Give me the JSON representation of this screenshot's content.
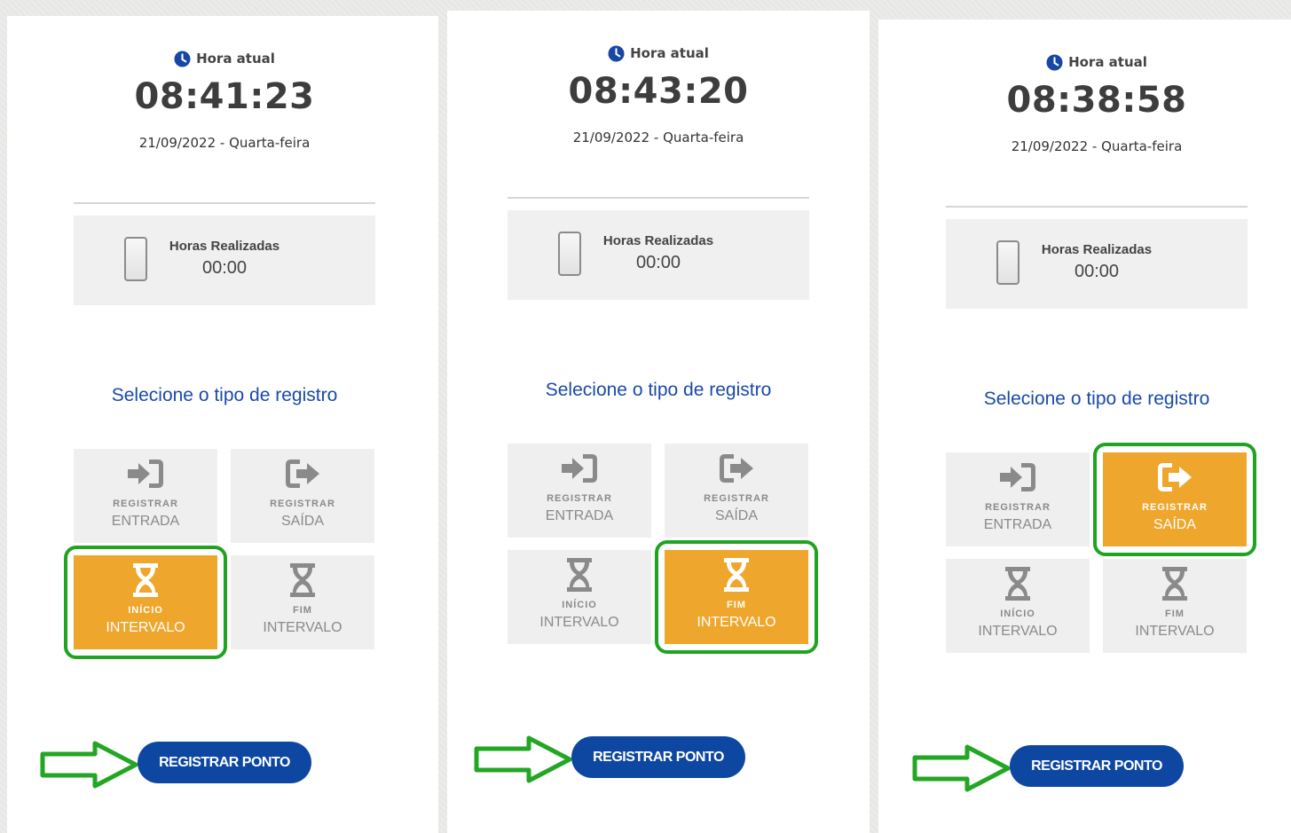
{
  "colors": {
    "accent_blue": "#0d47a1",
    "title_blue": "#1a4aa8",
    "selected_orange": "#efa62c",
    "highlight_green": "#20a320",
    "button_gray": "#efefef"
  },
  "icons": {
    "clock": "clock-icon",
    "device": "phone-icon",
    "entrada": "sign-in-arrow-icon",
    "saida": "sign-out-arrow-icon",
    "intervalo": "hourglass-icon",
    "pointer": "green-outline-arrow"
  },
  "panels": [
    {
      "hora_label": "Hora atual",
      "time": "08:41:23",
      "date": "21/09/2022 - Quarta-feira",
      "horas_label": "Horas Realizadas",
      "horas_value": "00:00",
      "select_title": "Selecione o tipo de registro",
      "selected": "inicio_intervalo",
      "buttons": {
        "entrada": {
          "small": "REGISTRAR",
          "big": "ENTRADA"
        },
        "saida": {
          "small": "REGISTRAR",
          "big": "SAÍDA"
        },
        "inicio": {
          "small": "INÍCIO",
          "big": "INTERVALO"
        },
        "fim": {
          "small": "FIM",
          "big": "INTERVALO"
        }
      },
      "submit_label": "REGISTRAR PONTO"
    },
    {
      "hora_label": "Hora atual",
      "time": "08:43:20",
      "date": "21/09/2022 - Quarta-feira",
      "horas_label": "Horas Realizadas",
      "horas_value": "00:00",
      "select_title": "Selecione o tipo de registro",
      "selected": "fim_intervalo",
      "buttons": {
        "entrada": {
          "small": "REGISTRAR",
          "big": "ENTRADA"
        },
        "saida": {
          "small": "REGISTRAR",
          "big": "SAÍDA"
        },
        "inicio": {
          "small": "INÍCIO",
          "big": "INTERVALO"
        },
        "fim": {
          "small": "FIM",
          "big": "INTERVALO"
        }
      },
      "submit_label": "REGISTRAR PONTO"
    },
    {
      "hora_label": "Hora atual",
      "time": "08:38:58",
      "date": "21/09/2022 - Quarta-feira",
      "horas_label": "Horas Realizadas",
      "horas_value": "00:00",
      "select_title": "Selecione o tipo de registro",
      "selected": "registrar_saida",
      "buttons": {
        "entrada": {
          "small": "REGISTRAR",
          "big": "ENTRADA"
        },
        "saida": {
          "small": "REGISTRAR",
          "big": "SAÍDA"
        },
        "inicio": {
          "small": "INÍCIO",
          "big": "INTERVALO"
        },
        "fim": {
          "small": "FIM",
          "big": "INTERVALO"
        }
      },
      "submit_label": "REGISTRAR PONTO"
    }
  ]
}
